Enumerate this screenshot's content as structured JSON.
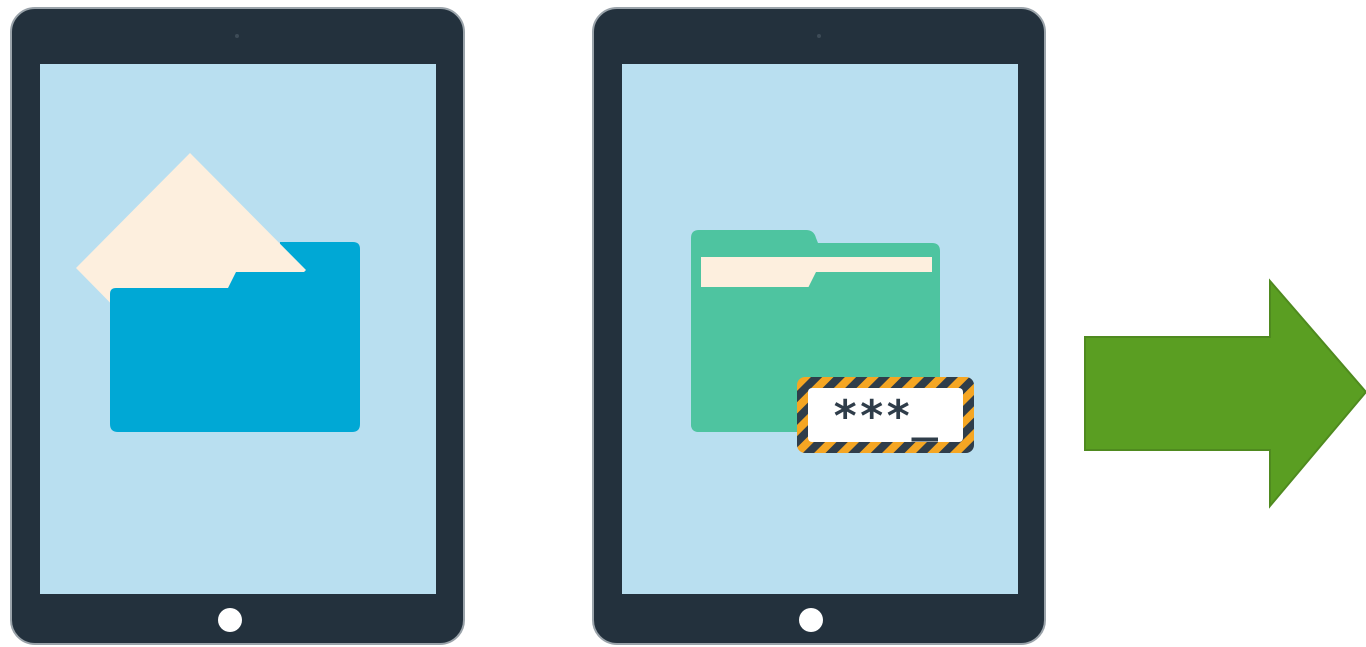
{
  "colors": {
    "background": "#ffffff",
    "tablet_body": "#23313d",
    "tablet_bezel_edge": "#9aa3aa",
    "screen": "#b9dff0",
    "home_button": "#ffffff",
    "folder_blue": "#00a8d5",
    "paper": "#fdefde",
    "folder_green": "#4ec4a0",
    "password_stripe_orange": "#f5a623",
    "password_stripe_dark": "#2f3d4a",
    "password_box": "#ffffff",
    "password_text": "#2f3d4a",
    "arrow_green": "#5a9e22",
    "arrow_edge": "#4f8a1f"
  },
  "icons": {
    "tablet_1": "tablet-icon",
    "tablet_2": "tablet-icon",
    "open_folder": "open-folder-with-document-icon",
    "locked_folder": "password-protected-folder-icon",
    "arrow": "right-arrow-icon"
  },
  "password_field": {
    "text": "***_"
  }
}
